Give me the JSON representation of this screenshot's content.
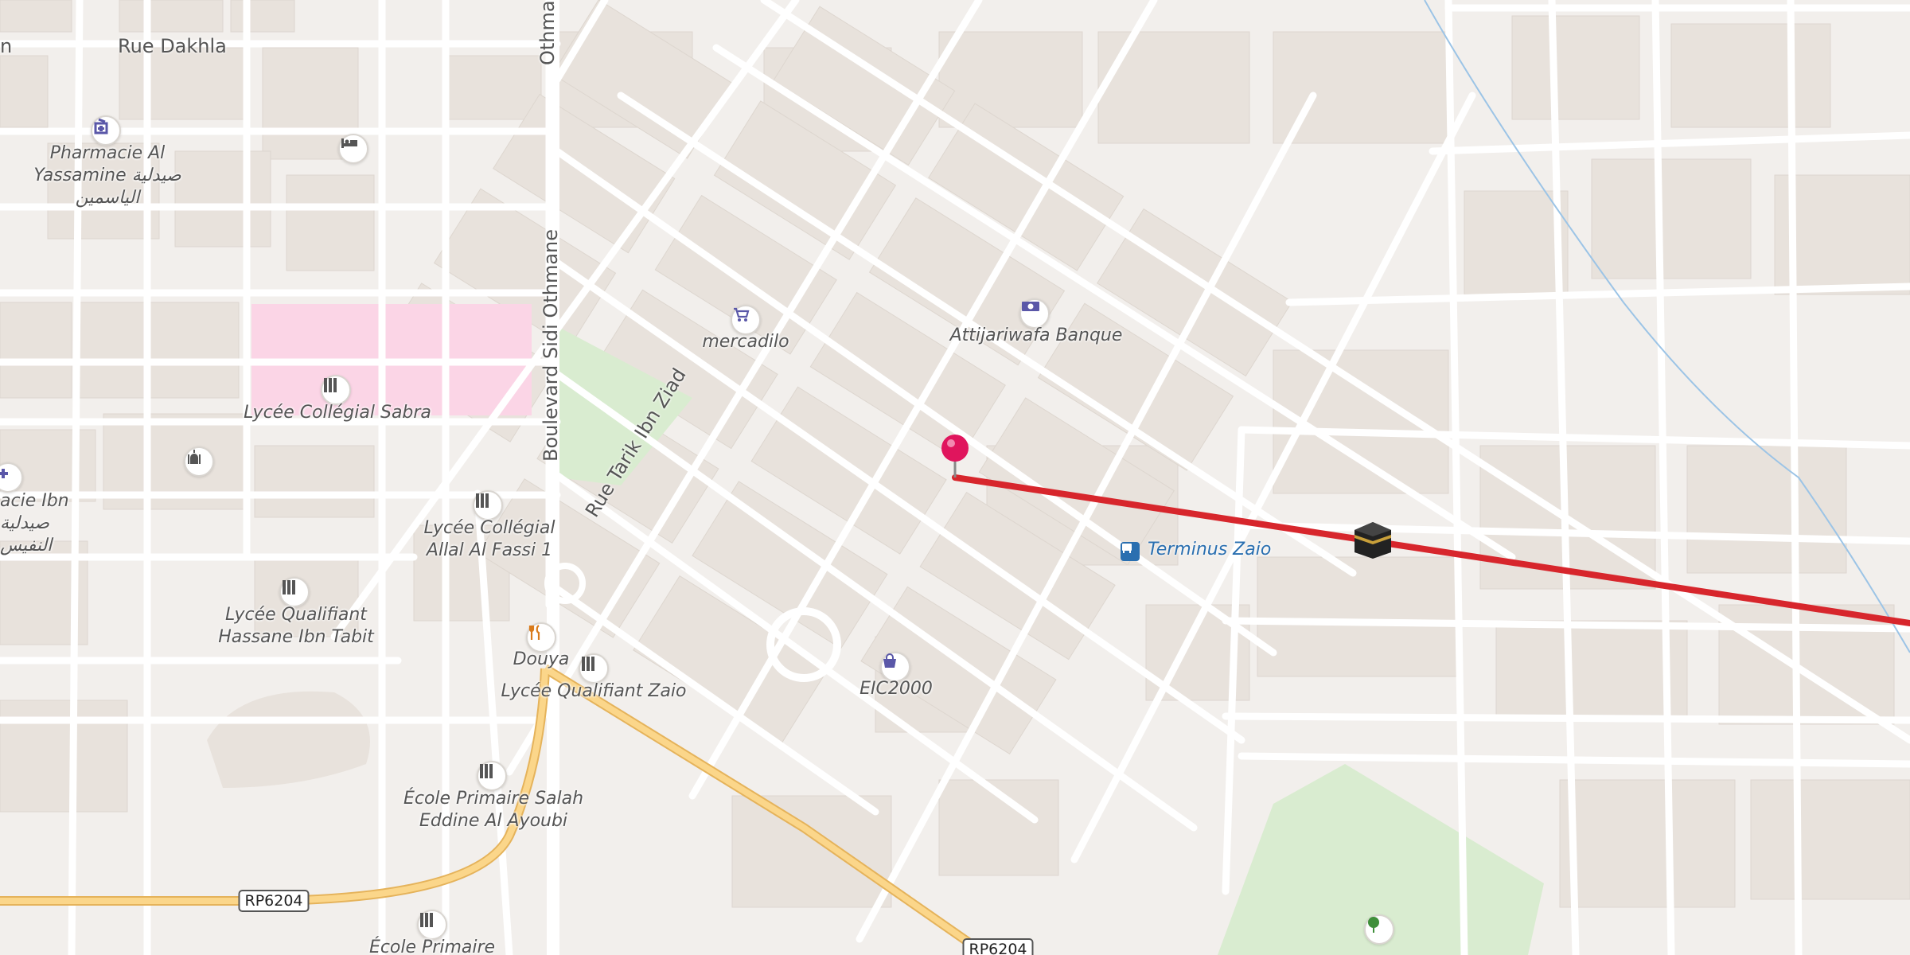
{
  "streets": {
    "rue_dakhla": "Rue Dakhla",
    "bd_sidi_othmane": "Boulevard Sidi Othmane",
    "bd_sidi_othmane_top": "Othmane",
    "rue_tarik": "Rue Tarik Ibn Ziad",
    "rp6204_a": "RP6204",
    "rp6204_b": "RP6204"
  },
  "places": {
    "pharmacie_yassamine": "Pharmacie Al\nYassamine صيدلية\nالياسمين",
    "pharmacie_ibn": "acie Ibn\nصيدلية\nالنفيس",
    "mercadilo": "mercadilo",
    "attijari": "Attijariwafa Banque",
    "lycee_sabra": "Lycée Collégial Sabra",
    "lycee_allal": "Lycée Collégial\nAllal Al Fassi 1",
    "lycee_hassane": "Lycée Qualifiant\nHassane Ibn Tabit",
    "douya": "Douya",
    "lycee_zaio": "Lycée Qualifiant Zaio",
    "eic2000": "EIC2000",
    "ecole_salah": "École Primaire Salah\nEddine Al Ayoubi",
    "ecole_primaire": "École Primaire",
    "terminus": "Terminus Zaio",
    "partial_left": "n"
  },
  "icons": {
    "pharmacy": "pharmacy-icon",
    "hotel": "bed-icon",
    "shop": "shopping-cart-icon",
    "bank": "banknote-icon",
    "school": "school-icon",
    "mosque": "mosque-icon",
    "restaurant": "fork-knife-icon",
    "shopping": "shopping-bag-icon",
    "bus": "bus-icon",
    "kaaba": "kaaba-icon",
    "park": "tree-icon",
    "pin": "location-pin-icon"
  },
  "colors": {
    "route": "#d7262c",
    "pin": "#e0155d",
    "park": "#d9ecd0",
    "school_area": "#fbd5e6",
    "major_road": "#fbd68a",
    "background": "#f2efec",
    "poi_icon": "#5a57a8"
  }
}
